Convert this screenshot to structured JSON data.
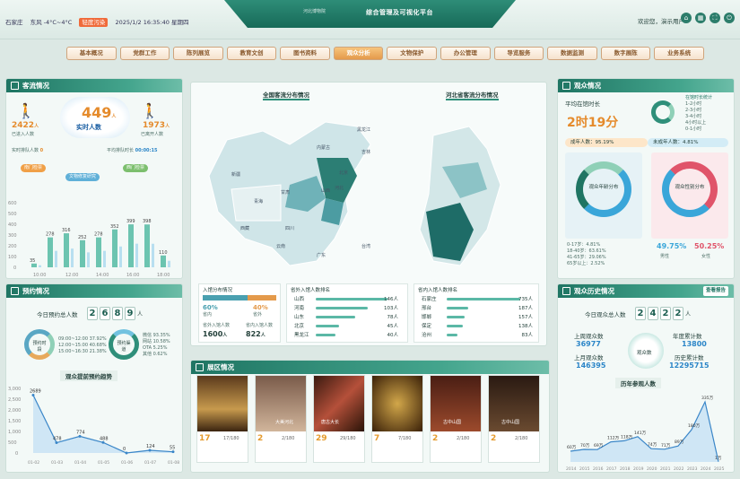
{
  "header": {
    "location": "石家庄",
    "weather": "东风 -4°C~4°C",
    "aq": "轻度污染",
    "datetime": "2025/1/2 16:35:40 星期四",
    "title": "综合管理及可视化平台",
    "logo": "河北博物院",
    "greeting": "欢迎您，演示用户"
  },
  "nav": [
    "基本概况",
    "党群工作",
    "陈列展览",
    "教育文创",
    "图书资料",
    "观众分析",
    "文物保护",
    "办公管理",
    "导览服务",
    "数据监测",
    "数字展陈",
    "业务系统"
  ],
  "visitor": {
    "title": "客流情况",
    "entered": "2422",
    "entered_unit": "人",
    "entered_label": "已进入人数",
    "realtime": "449",
    "realtime_unit": "人",
    "realtime_label": "实时人数",
    "left": "1973",
    "left_unit": "人",
    "left_label": "已离开人数",
    "queue_label": "实时排队人数",
    "queue_val": "0",
    "wait_label": "平均排队时长",
    "wait_val": "00:00:15",
    "chips": [
      "南门检票",
      "文物修复研究",
      "西门检票"
    ],
    "hours": [
      "10:00",
      "12:00",
      "14:00",
      "16:00",
      "18:00"
    ],
    "bars": [
      35,
      278,
      316,
      252,
      278,
      352,
      399,
      398,
      110
    ]
  },
  "reserve": {
    "title": "预约情况",
    "today_label": "今日预约总人数",
    "digits": [
      "2",
      "6",
      "8",
      "9"
    ],
    "unit": "人",
    "left_ring": "预约时段",
    "left_legend": [
      "09:00~12:00 37.92%",
      "12:00~15:00 40.68%",
      "15:00~16:30 21.38%"
    ],
    "right_ring": "预约渠道",
    "right_legend": [
      "微信 93.35%",
      "网站 10.58%",
      "OTA 5.25%",
      "其他 0.62%"
    ],
    "trend_title": "观众提前预约趋势",
    "trend": [
      2689,
      478,
      774,
      488,
      0,
      124,
      55
    ],
    "trend_x": [
      "01-02",
      "01-03",
      "01-04",
      "01-05",
      "01-06",
      "01-07",
      "01-08"
    ],
    "trend_y": [
      "3,000",
      "2,500",
      "2,000",
      "1,500",
      "1,000",
      "500",
      "0"
    ]
  },
  "map": {
    "title_left": "全国客流分布情况",
    "title_right": "河北省客流分布情况",
    "bottom_left_title": "入馆分布情况",
    "pct_a": "60%",
    "pct_a_label": "省内",
    "pct_b": "40%",
    "pct_b_label": "省外",
    "in_label": "省外入馆人数",
    "in_val": "1600",
    "in_unit": "人",
    "out_label": "省内入馆人数",
    "out_val": "822",
    "out_unit": "人",
    "nation_rank_title": "省外入馆人数排名",
    "nation": [
      {
        "n": "山西",
        "v": "146人"
      },
      {
        "n": "河南",
        "v": "103人"
      },
      {
        "n": "山东",
        "v": "78人"
      },
      {
        "n": "北京",
        "v": "45人"
      },
      {
        "n": "黑龙江",
        "v": "40人"
      }
    ],
    "prov_rank_title": "省内入馆人数排名",
    "prov": [
      {
        "n": "石家庄",
        "v": "735人"
      },
      {
        "n": "邢台",
        "v": "187人"
      },
      {
        "n": "邯郸",
        "v": "157人"
      },
      {
        "n": "保定",
        "v": "138人"
      },
      {
        "n": "沧州",
        "v": "83人"
      }
    ],
    "labels": [
      "新疆",
      "西藏",
      "青海",
      "内蒙古",
      "四川",
      "甘肃",
      "云南",
      "广东",
      "台湾",
      "黑龙江",
      "吉林",
      "北京",
      "河北",
      "山西"
    ]
  },
  "exhibit": {
    "title": "展区情况",
    "cards": [
      {
        "n": "17",
        "t": "17/180"
      },
      {
        "n": "2",
        "t": "2/180"
      },
      {
        "n": "29",
        "t": "29/180"
      },
      {
        "n": "7",
        "t": "7/180"
      },
      {
        "n": "2",
        "t": "2/180"
      },
      {
        "n": "2",
        "t": "2/180"
      }
    ],
    "captions": [
      "北区大厅",
      "大美河北",
      "唐古大长",
      "北区南厅",
      "古中山国",
      "古中山国"
    ]
  },
  "audience": {
    "title": "观众情况",
    "stay_label": "平均在馆时长",
    "stay_val": "2时19分",
    "stay_dist_label": "在馆时长统计",
    "stay_legend": [
      "1-2小时",
      "2-3小时",
      "3-4小时",
      "4小时以上",
      "0-1小时"
    ],
    "adult_label": "成年人数：",
    "adult_val": "95.19%",
    "minor_label": "未成年人数：",
    "minor_val": "4.81%",
    "age_label": "观众年龄分布",
    "gender_label": "观众性别分布",
    "age_legend": [
      "0-17岁：4.81%",
      "18-40岁：63.61%",
      "41-65岁：29.06%",
      "65岁以上：2.52%"
    ],
    "male": "49.75%",
    "female": "50.25%",
    "male_label": "男性",
    "female_label": "女性"
  },
  "history": {
    "title": "观众历史情况",
    "btn": "查看报告",
    "today_label": "今日观众总人数",
    "digits": [
      "2",
      "4",
      "2",
      "2"
    ],
    "unit": "人",
    "last_week_label": "上周观众数",
    "last_week": "36977",
    "year_label": "年度累计数",
    "year_val": "13800",
    "last_month_label": "上月观众数",
    "last_month": "146395",
    "total_label": "历史累计数",
    "total_val": "12295715",
    "center": "观众数",
    "trend_title": "历年参观人数",
    "years": [
      "2014",
      "2015",
      "2016",
      "2017",
      "2018",
      "2019",
      "2020",
      "2021",
      "2022",
      "2023",
      "2024",
      "2025"
    ],
    "values": [
      60,
      70,
      69,
      112,
      118,
      141,
      74,
      71,
      89,
      180,
      335,
      1
    ],
    "unit_label": "万"
  },
  "colors": {
    "primary": "#1f7563",
    "accent": "#e49a4b",
    "male": "#3aa6d9",
    "female": "#e0546a"
  }
}
